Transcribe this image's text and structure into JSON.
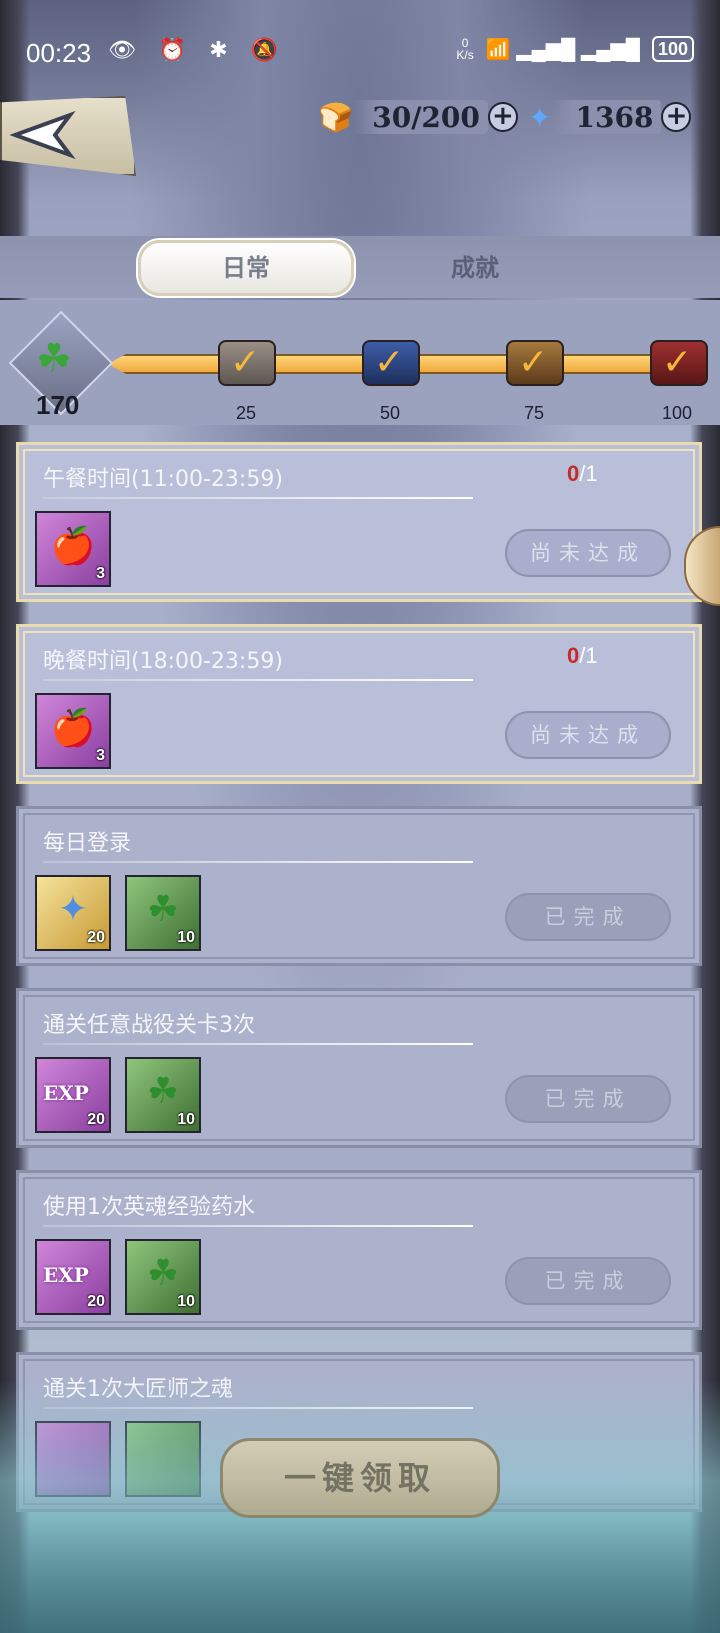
{
  "status_bar": {
    "time": "00:23",
    "icons_left": "👁 ⏰ ✱ 🔕",
    "speed_top": "0",
    "speed_bottom": "K/s",
    "signal": "📶 ▂▄▆█ ▂▄▆█",
    "battery": "100"
  },
  "header": {
    "back_icon": "back-arrow-icon",
    "stamina": "30/200",
    "gems": "1368"
  },
  "tabs": {
    "daily": "日常",
    "achievements": "成就"
  },
  "progress": {
    "score": "170",
    "score_icon": "clover-icon",
    "fill": 1.0,
    "milestones": [
      "25",
      "50",
      "75",
      "100"
    ]
  },
  "tasks": [
    {
      "title": "午餐时间(11:00-23:59)",
      "current": "0",
      "total": "/1",
      "status": "尚未达成",
      "rewards": [
        {
          "type": "apple",
          "qty": "3"
        }
      ]
    },
    {
      "title": "晚餐时间(18:00-23:59)",
      "current": "0",
      "total": "/1",
      "status": "尚未达成",
      "rewards": [
        {
          "type": "apple",
          "qty": "3"
        }
      ]
    },
    {
      "title": "每日登录",
      "status": "已完成",
      "rewards": [
        {
          "type": "gem",
          "qty": "20"
        },
        {
          "type": "clover",
          "qty": "10"
        }
      ]
    },
    {
      "title": "通关任意战役关卡3次",
      "status": "已完成",
      "rewards": [
        {
          "type": "exp",
          "label": "EXP",
          "qty": "20"
        },
        {
          "type": "clover",
          "qty": "10"
        }
      ]
    },
    {
      "title": "使用1次英魂经验药水",
      "status": "已完成",
      "rewards": [
        {
          "type": "exp",
          "label": "EXP",
          "qty": "20"
        },
        {
          "type": "clover",
          "qty": "10"
        }
      ]
    },
    {
      "title": "通关1次大匠师之魂"
    }
  ],
  "claim_all": "一键领取",
  "colors": {
    "count_current": "#c52a2a",
    "progress_fill": "#f0a93c"
  }
}
